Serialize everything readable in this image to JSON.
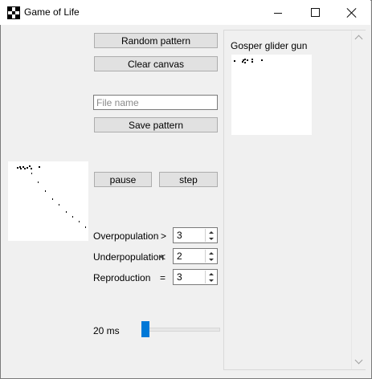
{
  "window": {
    "title": "Game of Life",
    "icon": "grid-icon"
  },
  "controls": {
    "random_label": "Random pattern",
    "clear_label": "Clear canvas",
    "file_name_placeholder": "File name",
    "file_name_value": "",
    "save_label": "Save pattern",
    "pause_label": "pause",
    "step_label": "step"
  },
  "rules": {
    "overpopulation": {
      "label": "Overpopulation",
      "op": ">",
      "value": "3"
    },
    "underpopulation": {
      "label": "Underpopulation",
      "op": "<",
      "value": "2"
    },
    "reproduction": {
      "label": "Reproduction",
      "op": "=",
      "value": "3"
    }
  },
  "speed": {
    "label": "20 ms",
    "fraction": 0.0
  },
  "patterns": {
    "items": [
      {
        "name": "Gosper glider gun"
      }
    ]
  },
  "colors": {
    "accent": "#0078d7",
    "window_bg": "#f0f0f0",
    "canvas_bg": "#ffffff"
  }
}
